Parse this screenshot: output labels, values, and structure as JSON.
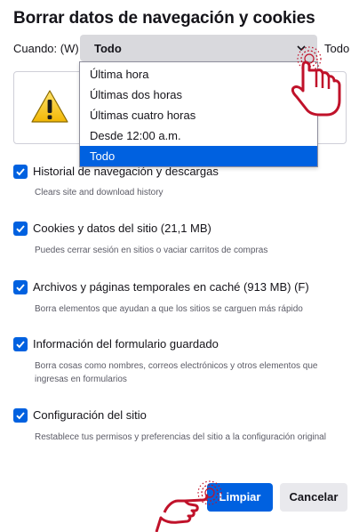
{
  "dialog": {
    "title": "Borrar datos de navegación y cookies",
    "when_label": "Cuando: (W)",
    "when_value": "Todo",
    "when_value_right": "Todo"
  },
  "dropdown": {
    "options": [
      {
        "label": "Última hora"
      },
      {
        "label": "Últimas dos horas"
      },
      {
        "label": "Últimas cuatro horas"
      },
      {
        "label": "Desde 12:00 a.m."
      },
      {
        "label": "Todo",
        "selected": true
      }
    ]
  },
  "options": [
    {
      "label": "Historial de navegación y descargas",
      "desc": "Clears site and download history",
      "checked": true
    },
    {
      "label": "Cookies y datos del sitio (21,1 MB)",
      "desc": "Puedes cerrar sesión en sitios o vaciar carritos de compras",
      "checked": true
    },
    {
      "label": "Archivos y páginas temporales en caché (913 MB) (F)",
      "desc": "Borra elementos que ayudan a que los sitios se carguen más rápido",
      "checked": true
    },
    {
      "label": "Información del formulario guardado",
      "desc": "Borra cosas como nombres, correos electrónicos y otros elementos que ingresas en formularios",
      "checked": true
    },
    {
      "label": "Configuración del sitio",
      "desc": "Restablece tus permisos y preferencias del sitio a la configuración original",
      "checked": true
    }
  ],
  "buttons": {
    "clear": "Limpiar",
    "cancel": "Cancelar"
  },
  "colors": {
    "accent": "#0061e0",
    "pointer_hand": "#c0122a"
  },
  "icons": [
    "warning-icon",
    "chevron-down-icon",
    "checkmark-icon",
    "pointer-hand-icon"
  ]
}
